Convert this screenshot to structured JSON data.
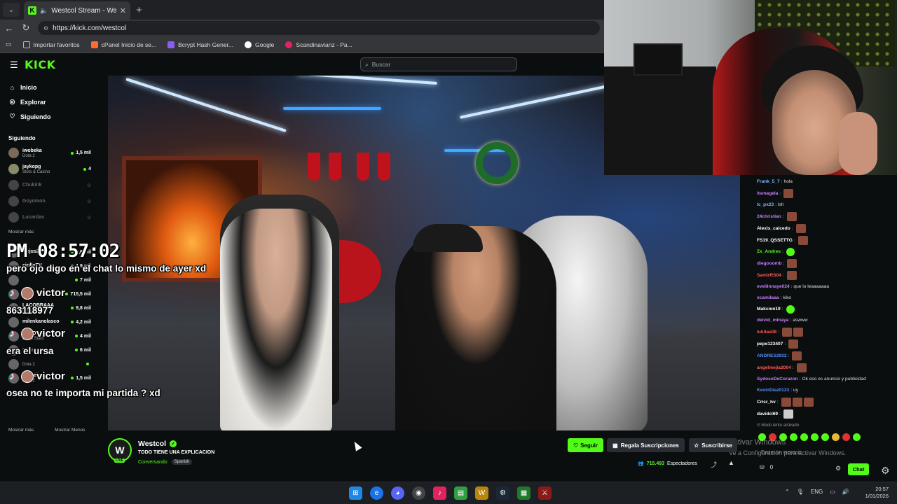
{
  "browser": {
    "tab_title": "Westcol Stream - Watch Live",
    "url": "https://kick.com/westcol",
    "bookmarks": [
      "Importar favoritos",
      "cPanel Inicio de se...",
      "Bcrypt Hash Gener...",
      "Google",
      "Scandinavianz - Pa..."
    ]
  },
  "kick": {
    "logo": "KICK",
    "search_placeholder": "Buscar"
  },
  "sidebar": {
    "nav": [
      {
        "label": "Inicio",
        "icon": "home-icon"
      },
      {
        "label": "Explorar",
        "icon": "compass-icon"
      },
      {
        "label": "Siguiendo",
        "icon": "heart-icon"
      }
    ],
    "following_title": "Siguiendo",
    "channels": [
      {
        "name": "iwobeka",
        "category": "Dota 2",
        "viewers": "1,5 mil",
        "online": true
      },
      {
        "name": "jaykopg",
        "category": "Slots & Casino",
        "viewers": "4",
        "online": true
      },
      {
        "name": "Chukink",
        "category": "",
        "viewers": "",
        "online": false
      },
      {
        "name": "Goyomon",
        "category": "",
        "viewers": "",
        "online": false
      },
      {
        "name": "Lucardas",
        "category": "",
        "viewers": "",
        "online": false
      }
    ],
    "show_more": "Mostrar más",
    "more_channels": [
      {
        "name": "alejus28",
        "category": "",
        "viewers": "2,6 mil"
      },
      {
        "name": "cirilloTV",
        "category": "",
        "viewers": "1,9 mil"
      },
      {
        "name": "",
        "category": "",
        "viewers": "7 mil"
      },
      {
        "name": "",
        "category": "",
        "viewers": "715,5 mil"
      },
      {
        "name": "LACOBRAAA",
        "category": "Conversando",
        "viewers": "9,8 mil"
      },
      {
        "name": "milenkanolasco",
        "category": "",
        "viewers": "4,2 mil"
      },
      {
        "name": "ZEKO",
        "category": "Brawl Stars",
        "viewers": "4 mil"
      },
      {
        "name": "",
        "category": "Brawl Stars",
        "viewers": "6 mil"
      },
      {
        "name": "",
        "category": "Dota 2",
        "viewers": ""
      },
      {
        "name": "iwobeka",
        "category": "Dota 2",
        "viewers": "1,5 mil"
      }
    ],
    "bottom_show_more": "Mostrar más",
    "bottom_show_less": "Mostrar Menos"
  },
  "overlay": {
    "clock": "PM 08:57:02",
    "line1": "pero ojo digo en el chat lo mismo de ayer xd",
    "tiktok_name": "victor",
    "number": "863118977",
    "line2": "era el ursa",
    "line3": "osea no te importa mi partida ? xd"
  },
  "chat": {
    "messages": [
      {
        "user": "Frank_5_7",
        "color": "#7fb6ff",
        "text": "hola",
        "emotes": 0
      },
      {
        "user": "itsmagela",
        "color": "#c77dff",
        "text": "",
        "emotes": 1
      },
      {
        "user": "lc_px23",
        "color": "#7fb6ff",
        "text": "lsh",
        "emotes": 0
      },
      {
        "user": "24christian",
        "color": "#c77dff",
        "text": "",
        "emotes": 1
      },
      {
        "user": "Alexis_caicedo",
        "color": "#ffffff",
        "text": "",
        "emotes": 1
      },
      {
        "user": "FS19_QSSETTG",
        "color": "#ffffff",
        "text": "",
        "emotes": 1
      },
      {
        "user": "Zx_Andres",
        "color": "#53fc18",
        "text": "",
        "emotes": 1
      },
      {
        "user": "diegooomb",
        "color": "#c77dff",
        "text": "",
        "emotes": 1
      },
      {
        "user": "SamirRS04",
        "color": "#ff5a5a",
        "text": "",
        "emotes": 1
      },
      {
        "user": "evellinnaye024",
        "color": "#c77dff",
        "text": "que lo leaaaaaaa",
        "emotes": 0
      },
      {
        "user": "xcamilaaa",
        "color": "#c77dff",
        "text": "kiko",
        "emotes": 0
      },
      {
        "user": "Makcion19",
        "color": "#ffffff",
        "text": "",
        "emotes": 1
      },
      {
        "user": "deivid_minaya",
        "color": "#c77dff",
        "text": "aswww",
        "emotes": 0
      },
      {
        "user": "lukitas08",
        "color": "#ff5a5a",
        "text": "",
        "emotes": 2
      },
      {
        "user": "pepe123407",
        "color": "#ffffff",
        "text": "",
        "emotes": 1
      },
      {
        "user": "ANDRES2932",
        "color": "#4f8cff",
        "text": "",
        "emotes": 1
      },
      {
        "user": "angelmejia2004",
        "color": "#ff5a5a",
        "text": "",
        "emotes": 1
      },
      {
        "user": "SydosoDeCorazon",
        "color": "#c77dff",
        "text": "Ok eso es anuncio y publicidad",
        "emotes": 0
      },
      {
        "user": "KevinDiaz0123",
        "color": "#4f8cff",
        "text": "uy",
        "emotes": 0
      },
      {
        "user": "Crisr_hv",
        "color": "#ffffff",
        "text": "",
        "emotes": 3
      },
      {
        "user": "davidcl69",
        "color": "#ffffff",
        "text": "",
        "emotes": 1
      }
    ],
    "slow_mode": "Modo lento activado",
    "input_placeholder": "Enviar un mensaje",
    "points": "0",
    "chat_button": "Chat"
  },
  "stream": {
    "channel": "Westcol",
    "title": "TODO TIENE UNA EXPLICACION",
    "category": "Conversando",
    "language": "Spanish",
    "live_badge": "LIVE",
    "follow": "Seguir",
    "gift": "Regala Suscripciones",
    "subscribe": "Suscribirse",
    "viewers": "715.493",
    "viewers_label": "Espectadores"
  },
  "windows_watermark": {
    "line1": "Activar Windows",
    "line2": "Ve a Configuración para activar Windows."
  },
  "taskbar": {
    "lang": "ENG",
    "time": "20:57",
    "date": "1/01/2026"
  },
  "colors": {
    "kick_green": "#53fc18",
    "background": "#0b0e0f"
  }
}
